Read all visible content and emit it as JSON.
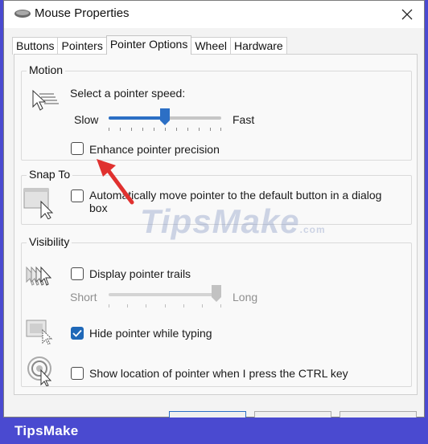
{
  "window": {
    "title": "Mouse Properties",
    "close_glyph": "✕"
  },
  "tabs": [
    {
      "label": "Buttons"
    },
    {
      "label": "Pointers"
    },
    {
      "label": "Pointer Options",
      "active": true
    },
    {
      "label": "Wheel"
    },
    {
      "label": "Hardware"
    }
  ],
  "motion": {
    "group_label": "Motion",
    "speed_label": "Select a pointer speed:",
    "slow_label": "Slow",
    "fast_label": "Fast",
    "speed_value_fraction": 0.5,
    "precision_label": "Enhance pointer precision",
    "precision_checked": false
  },
  "snap_to": {
    "group_label": "Snap To",
    "auto_move_label_line1": "Automatically move pointer to the default button in a dialog",
    "auto_move_label_line2": "box",
    "auto_move_checked": false
  },
  "visibility": {
    "group_label": "Visibility",
    "trails_label": "Display pointer trails",
    "trails_checked": false,
    "short_label": "Short",
    "long_label": "Long",
    "trails_length_fraction": 1.0,
    "hide_typing_label": "Hide pointer while typing",
    "hide_typing_checked": true,
    "show_location_label": "Show location of pointer when I press the CTRL key",
    "show_location_checked": false
  },
  "watermark": {
    "text": "TipsMake",
    "suffix": ".com"
  },
  "footer": {
    "brand": "TipsMake"
  },
  "colors": {
    "accent": "#2c6fc5",
    "annotation_arrow": "#e0312f",
    "frame": "#4a4ad0"
  }
}
